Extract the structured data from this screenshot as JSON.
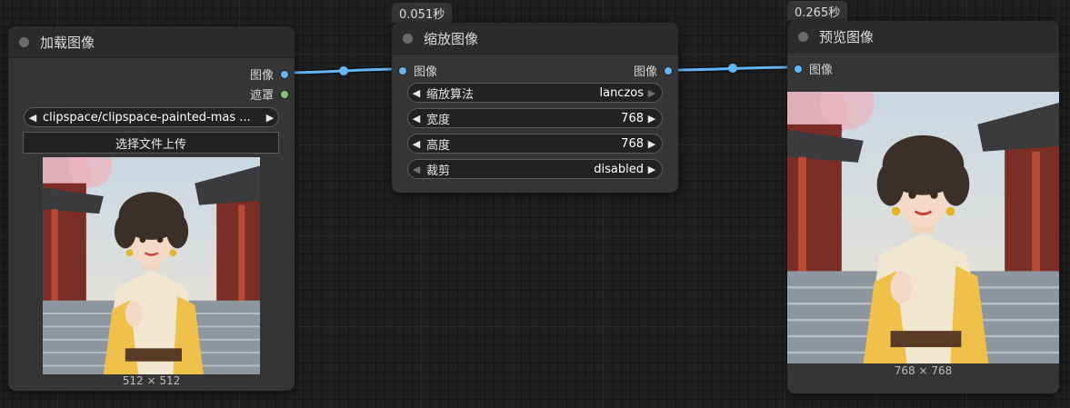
{
  "load_node": {
    "title": "加载图像",
    "outputs": [
      "图像",
      "遮罩"
    ],
    "image_combo": "clipspace/clipspace-painted-mas ...",
    "upload_button": "选择文件上传",
    "image_size": "512 × 512"
  },
  "scale_node": {
    "timing": "0.051秒",
    "title": "缩放图像",
    "input": "图像",
    "output": "图像",
    "widgets": [
      {
        "label": "缩放算法",
        "value": "lanczos"
      },
      {
        "label": "宽度",
        "value": "768"
      },
      {
        "label": "高度",
        "value": "768"
      },
      {
        "label": "裁剪",
        "value": "disabled"
      }
    ]
  },
  "preview_node": {
    "timing": "0.265秒",
    "title": "预览图像",
    "input": "图像",
    "image_size": "768 × 768"
  },
  "colors": {
    "canvas": "#1f1f1f",
    "node_body": "#353535",
    "node_title": "#2b2b2b",
    "link": "#64b5f6",
    "mask_slot": "#7ec87e"
  },
  "icons": [
    "left-arrow-icon",
    "right-arrow-icon",
    "title-dot-icon",
    "image-thumbnail"
  ]
}
